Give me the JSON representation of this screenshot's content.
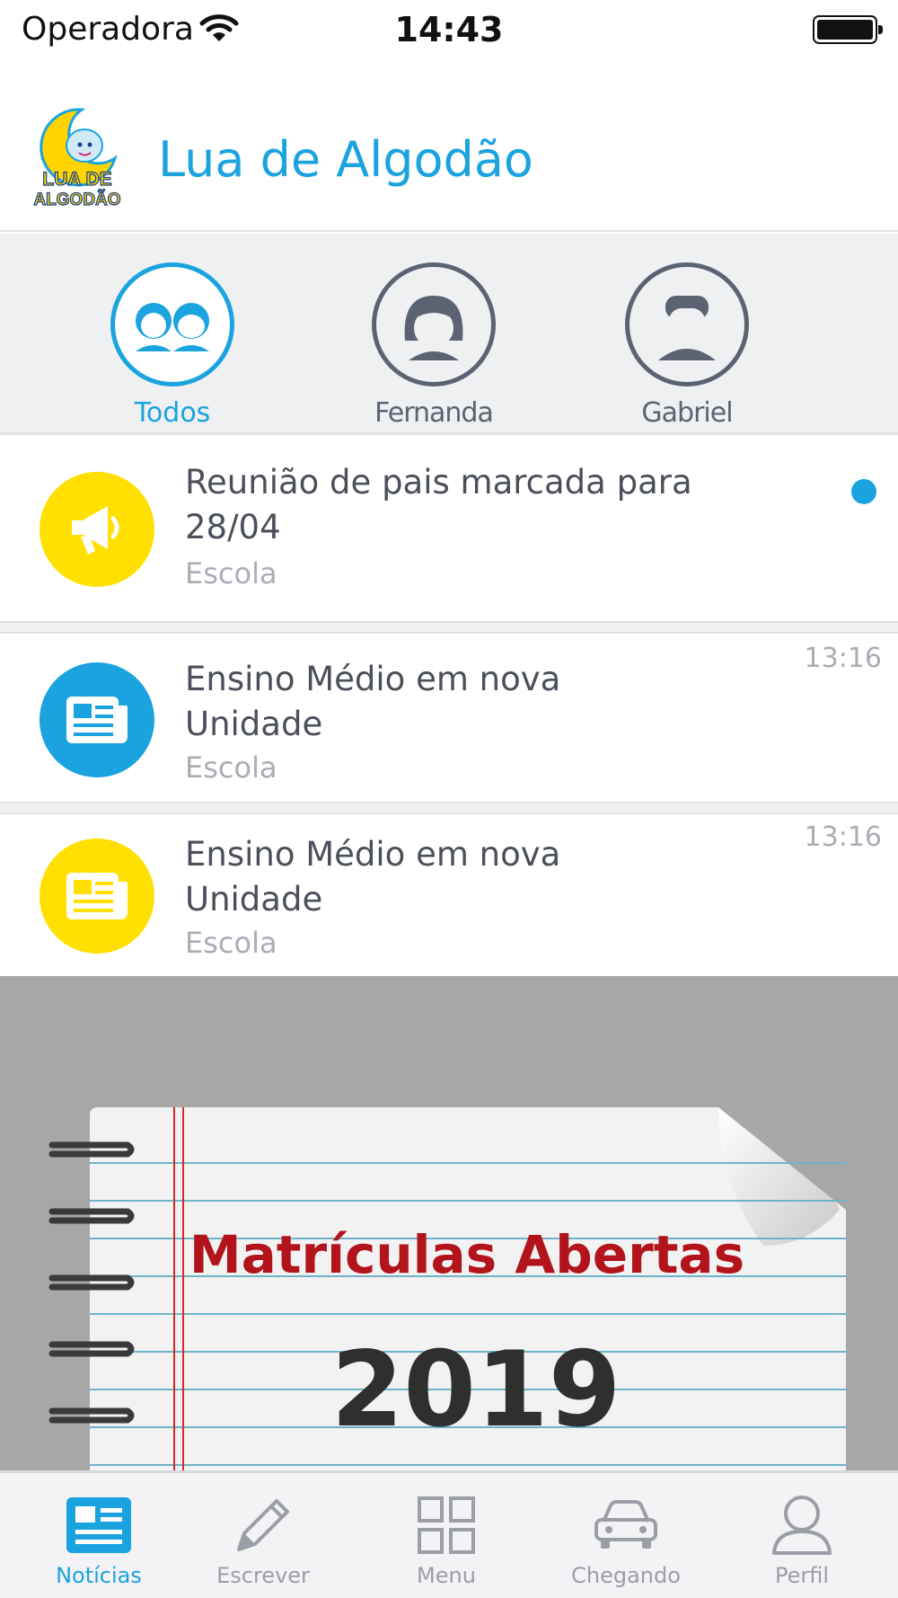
{
  "status_bar": {
    "carrier": "Operadora",
    "time": "14:43"
  },
  "header": {
    "title": "Lua de Algodão",
    "logo_text_1": "LUA DE",
    "logo_text_2": "ALGODÃO"
  },
  "children": [
    {
      "label": "Todos",
      "icon": "group-icon",
      "active": true
    },
    {
      "label": "Fernanda",
      "icon": "girl-avatar-icon",
      "active": false
    },
    {
      "label": "Gabriel",
      "icon": "boy-avatar-icon",
      "active": false
    }
  ],
  "feed": [
    {
      "title": "Reunião de pais marcada para 28/04",
      "source": "Escola",
      "time": "",
      "icon": "megaphone-icon",
      "color": "#ffe000",
      "unread": true
    },
    {
      "title": "Ensino Médio em nova Unidade",
      "source": "Escola",
      "time": "13:16",
      "icon": "newspaper-icon",
      "color": "#1aa3df",
      "unread": false
    },
    {
      "title": "Ensino Médio em nova Unidade",
      "source": "Escola",
      "time": "13:16",
      "icon": "newspaper-icon",
      "color": "#ffe000",
      "unread": false
    }
  ],
  "banner": {
    "headline": "Matrículas Abertas",
    "year": "2019"
  },
  "tabs": [
    {
      "label": "Notícias",
      "icon": "news-icon",
      "active": true
    },
    {
      "label": "Escrever",
      "icon": "pencil-icon",
      "active": false
    },
    {
      "label": "Menu",
      "icon": "grid-icon",
      "active": false
    },
    {
      "label": "Chegando",
      "icon": "car-icon",
      "active": false
    },
    {
      "label": "Perfil",
      "icon": "person-icon",
      "active": false
    }
  ],
  "colors": {
    "accent": "#1aa3df",
    "yellow": "#ffe000",
    "gray_text": "#5b6272",
    "banner_red": "#b3141b"
  }
}
